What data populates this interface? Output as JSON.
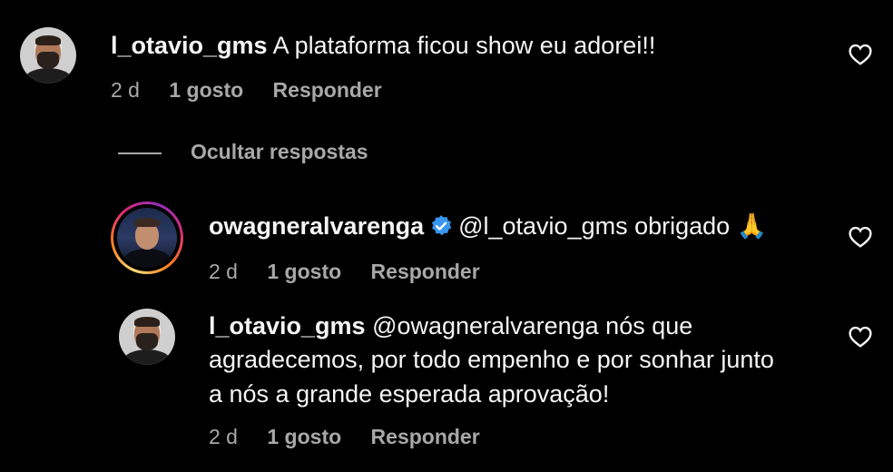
{
  "comments": [
    {
      "username": "l_otavio_gms",
      "text": "A plataforma ficou show eu adorei!!",
      "time": "2 d",
      "likes": "1 gosto",
      "reply": "Responder"
    },
    {
      "username": "owagneralvarenga",
      "verified": true,
      "mention": "@l_otavio_gms",
      "text": "obrigado 🙏",
      "time": "2 d",
      "likes": "1 gosto",
      "reply": "Responder"
    },
    {
      "username": "l_otavio_gms",
      "mention": "@owagneralvarenga",
      "text_line1": "nós que",
      "text_line2": "agradecemos, por todo empenho e por sonhar junto",
      "text_line3": "a nós a grande esperada aprovação!",
      "time": "2 d",
      "likes": "1 gosto",
      "reply": "Responder"
    }
  ],
  "hide_replies": "Ocultar respostas",
  "icons": {
    "like": "heart-outline-icon",
    "verified": "verified-badge-icon"
  },
  "colors": {
    "background": "#000000",
    "text": "#f5f5f5",
    "muted": "#a8a8a8",
    "verified": "#3897f0"
  }
}
